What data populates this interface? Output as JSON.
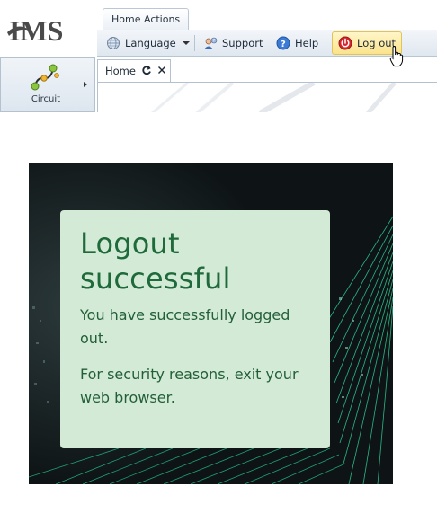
{
  "app": {
    "logo_text": "IMS"
  },
  "tabs": {
    "ribbon_tab": "Home Actions"
  },
  "toolbar": {
    "language_label": "Language",
    "support_label": "Support",
    "help_label": "Help",
    "logout_label": "Log out"
  },
  "sidebar": {
    "items": [
      {
        "label": "Circuit",
        "icon": "circuit-icon"
      }
    ]
  },
  "document_tabs": [
    {
      "label": "Home",
      "icons": [
        "refresh-icon",
        "close-icon"
      ]
    }
  ],
  "logout": {
    "title": "Logout successful",
    "message_1": "You have successfully logged out.",
    "message_2": "For security reasons, exit your web browser."
  },
  "colors": {
    "card_background": "#d3ead6",
    "card_text": "#1f6a3a",
    "backdrop": "#0f1516",
    "accent_green": "#2fd39a",
    "logout_highlight": "#fbe38c"
  }
}
